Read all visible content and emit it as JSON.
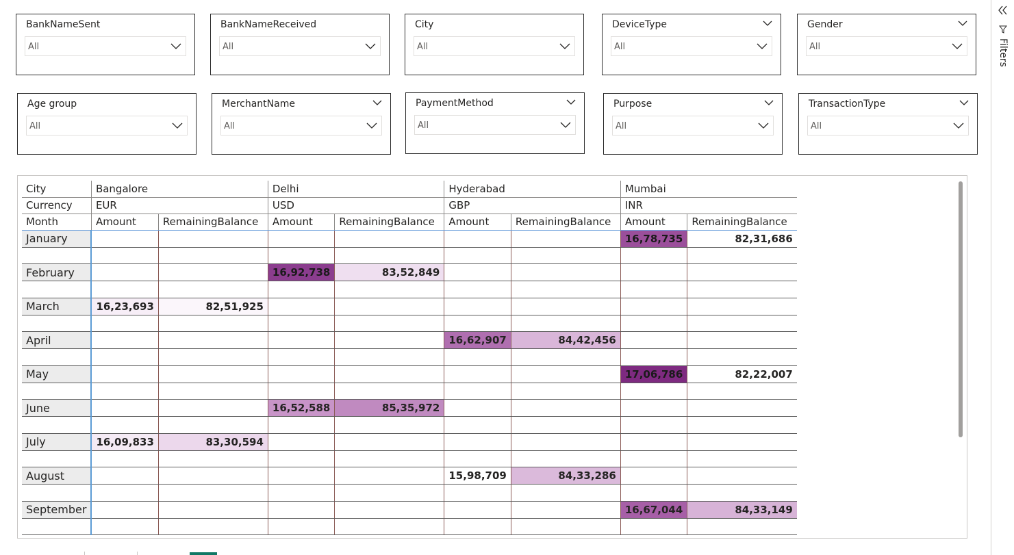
{
  "slicers": [
    {
      "title": "BankNameSent",
      "value": "All"
    },
    {
      "title": "BankNameReceived",
      "value": "All"
    },
    {
      "title": "City",
      "value": "All"
    },
    {
      "title": "DeviceType",
      "value": "All"
    },
    {
      "title": "Gender",
      "value": "All"
    },
    {
      "title": "Age group",
      "value": "All"
    },
    {
      "title": "MerchantName",
      "value": "All"
    },
    {
      "title": "PaymentMethod",
      "value": "All"
    },
    {
      "title": "Purpose",
      "value": "All"
    },
    {
      "title": "TransactionType",
      "value": "All"
    }
  ],
  "matrix": {
    "row_headers": [
      "City",
      "Currency",
      "Month"
    ],
    "cities": [
      {
        "name": "Bangalore",
        "currency": "EUR"
      },
      {
        "name": "Delhi",
        "currency": "USD"
      },
      {
        "name": "Hyderabad",
        "currency": "GBP"
      },
      {
        "name": "Mumbai",
        "currency": "INR"
      }
    ],
    "measures": [
      "Amount",
      "RemainingBalance"
    ],
    "rows": [
      {
        "month": "January",
        "cells": [
          "",
          "",
          "",
          "",
          "",
          "",
          "16,78,735",
          "82,31,686"
        ]
      },
      {
        "month": "February",
        "cells": [
          "",
          "",
          "16,92,738",
          "83,52,849",
          "",
          "",
          "",
          ""
        ]
      },
      {
        "month": "March",
        "cells": [
          "16,23,693",
          "82,51,925",
          "",
          "",
          "",
          "",
          "",
          ""
        ]
      },
      {
        "month": "April",
        "cells": [
          "",
          "",
          "",
          "",
          "16,62,907",
          "84,42,456",
          "",
          ""
        ]
      },
      {
        "month": "May",
        "cells": [
          "",
          "",
          "",
          "",
          "",
          "",
          "17,06,786",
          "82,22,007"
        ]
      },
      {
        "month": "June",
        "cells": [
          "",
          "",
          "16,52,588",
          "85,35,972",
          "",
          "",
          "",
          ""
        ]
      },
      {
        "month": "July",
        "cells": [
          "16,09,833",
          "83,30,594",
          "",
          "",
          "",
          "",
          "",
          ""
        ]
      },
      {
        "month": "August",
        "cells": [
          "",
          "",
          "",
          "",
          "15,98,709",
          "84,33,286",
          "",
          ""
        ]
      },
      {
        "month": "September",
        "cells": [
          "",
          "",
          "",
          "",
          "",
          "",
          "16,67,044",
          "84,33,149"
        ]
      }
    ],
    "cell_colors": {
      "January": [
        "",
        "",
        "",
        "",
        "",
        "",
        "#9b4f9b",
        "#ffffff"
      ],
      "February": [
        "",
        "",
        "#8b3d8e",
        "#efdff0",
        "",
        "",
        "",
        ""
      ],
      "March": [
        "#f7eef7",
        "#fbf6fb",
        "",
        "",
        "",
        "",
        "",
        ""
      ],
      "April": [
        "",
        "",
        "",
        "",
        "#b06fb0",
        "#d9b6d9",
        "",
        ""
      ],
      "May": [
        "",
        "",
        "",
        "",
        "",
        "",
        "#7e2a80",
        "#ffffff"
      ],
      "June": [
        "",
        "",
        "#c894c8",
        "#c08ac0",
        "",
        "",
        "",
        ""
      ],
      "July": [
        "#f5ebf5",
        "#ecd8ec",
        "",
        "",
        "",
        "",
        "",
        ""
      ],
      "August": [
        "",
        "",
        "",
        "",
        "#ffffff",
        "#dbbadb",
        "",
        ""
      ],
      "September": [
        "",
        "",
        "",
        "",
        "",
        "",
        "#a75fa7",
        "#d7b3d7"
      ]
    }
  },
  "filters_pane": {
    "label": "Filters",
    "collapse_icon": "double-chevron-left-icon",
    "funnel_icon": "filter-funnel-icon"
  }
}
